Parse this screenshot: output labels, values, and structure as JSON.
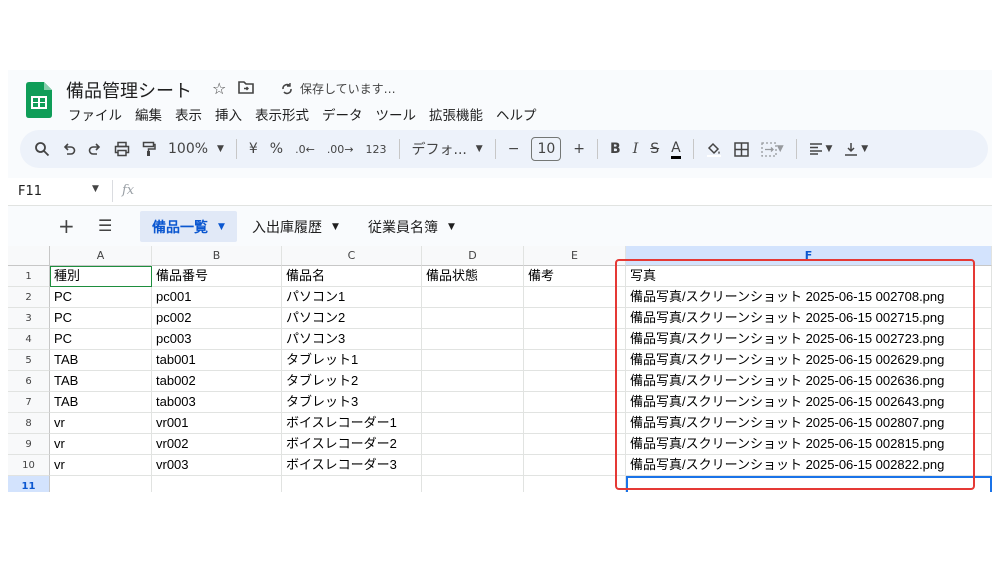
{
  "doc": {
    "title": "備品管理シート",
    "saving_status": "保存しています…"
  },
  "menu": [
    "ファイル",
    "編集",
    "表示",
    "挿入",
    "表示形式",
    "データ",
    "ツール",
    "拡張機能",
    "ヘルプ"
  ],
  "toolbar": {
    "zoom": "100%",
    "currency": "¥",
    "percent": "%",
    "dec_decrease": ".0",
    "dec_increase": ".00",
    "number_format": "123",
    "font_name": "デフォ...",
    "font_size": "10",
    "minus": "−",
    "plus": "+",
    "bold": "B",
    "italic": "I",
    "strike": "S",
    "text_color": "A"
  },
  "formula_bar": {
    "cell_ref": "F11",
    "fx": "fx"
  },
  "sheet_tabs": [
    {
      "label": "備品一覧",
      "active": true
    },
    {
      "label": "入出庫履歴",
      "active": false
    },
    {
      "label": "従業員名簿",
      "active": false
    }
  ],
  "columns": [
    "A",
    "B",
    "C",
    "D",
    "E",
    "F"
  ],
  "rows": [
    {
      "num": "1",
      "cells": [
        "種別",
        "備品番号",
        "備品名",
        "備品状態",
        "備考",
        "写真"
      ]
    },
    {
      "num": "2",
      "cells": [
        "PC",
        "pc001",
        "パソコン1",
        "",
        "",
        "備品写真/スクリーンショット 2025-06-15 002708.png"
      ]
    },
    {
      "num": "3",
      "cells": [
        "PC",
        "pc002",
        "パソコン2",
        "",
        "",
        "備品写真/スクリーンショット 2025-06-15 002715.png"
      ]
    },
    {
      "num": "4",
      "cells": [
        "PC",
        "pc003",
        "パソコン3",
        "",
        "",
        "備品写真/スクリーンショット 2025-06-15 002723.png"
      ]
    },
    {
      "num": "5",
      "cells": [
        "TAB",
        "tab001",
        "タブレット1",
        "",
        "",
        "備品写真/スクリーンショット 2025-06-15 002629.png"
      ]
    },
    {
      "num": "6",
      "cells": [
        "TAB",
        "tab002",
        "タブレット2",
        "",
        "",
        "備品写真/スクリーンショット 2025-06-15 002636.png"
      ]
    },
    {
      "num": "7",
      "cells": [
        "TAB",
        "tab003",
        "タブレット3",
        "",
        "",
        "備品写真/スクリーンショット 2025-06-15 002643.png"
      ]
    },
    {
      "num": "8",
      "cells": [
        "vr",
        "vr001",
        "ボイスレコーダー1",
        "",
        "",
        "備品写真/スクリーンショット 2025-06-15 002807.png"
      ]
    },
    {
      "num": "9",
      "cells": [
        "vr",
        "vr002",
        "ボイスレコーダー2",
        "",
        "",
        "備品写真/スクリーンショット 2025-06-15 002815.png"
      ]
    },
    {
      "num": "10",
      "cells": [
        "vr",
        "vr003",
        "ボイスレコーダー3",
        "",
        "",
        "備品写真/スクリーンショット 2025-06-15 002822.png"
      ]
    },
    {
      "num": "11",
      "cells": [
        "",
        "",
        "",
        "",
        "",
        ""
      ]
    }
  ],
  "colors": {
    "accent": "#0b57d0",
    "highlight": "#e53935",
    "logo": "#0f9d58"
  }
}
